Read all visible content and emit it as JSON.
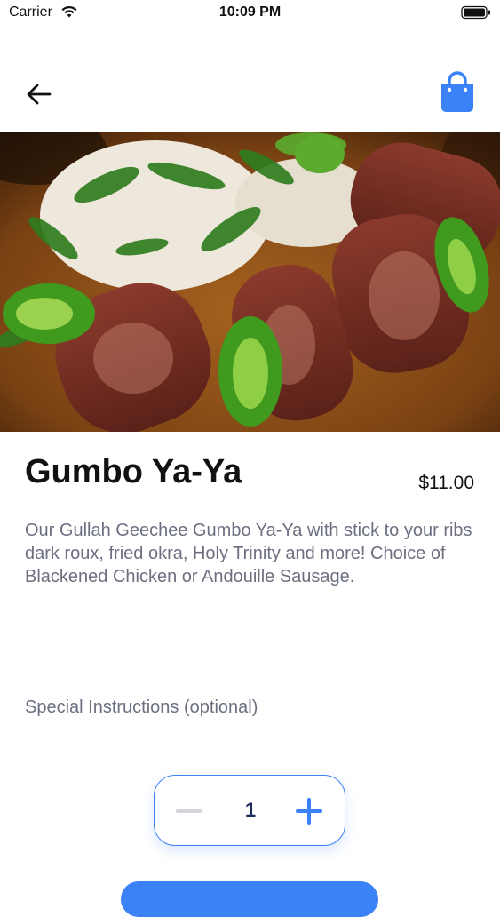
{
  "status_bar": {
    "carrier": "Carrier",
    "time": "10:09 PM"
  },
  "nav": {
    "back_icon": "arrow-left-icon",
    "cart_icon": "shopping-bag-icon",
    "accent_color": "#3b82f6"
  },
  "item": {
    "image_alt": "",
    "title": "Gumbo Ya-Ya",
    "price": "$11.00",
    "description": "Our Gullah Geechee Gumbo Ya-Ya with stick to your ribs dark roux, fried okra, Holy Trinity and more! Choice of Blackened Chicken or Andouille Sausage."
  },
  "instructions": {
    "placeholder": "Special Instructions (optional)"
  },
  "quantity": {
    "value": "1",
    "minus_icon": "minus-icon",
    "plus_icon": "plus-icon"
  }
}
